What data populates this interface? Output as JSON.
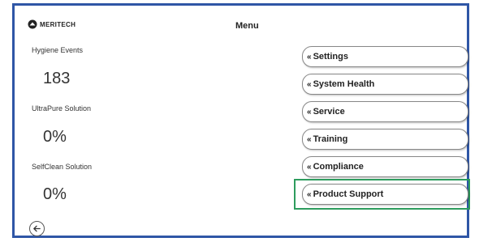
{
  "header": {
    "logo_text": "MERITECH",
    "title": "Menu"
  },
  "stats": [
    {
      "label": "Hygiene Events",
      "value": "183"
    },
    {
      "label": "UltraPure Solution",
      "value": "0%"
    },
    {
      "label": "SelfClean Solution",
      "value": "0%"
    }
  ],
  "menu": {
    "chevron": "«",
    "items": [
      {
        "label": "Settings"
      },
      {
        "label": "System Health"
      },
      {
        "label": "Service"
      },
      {
        "label": "Training"
      },
      {
        "label": "Compliance"
      },
      {
        "label": "Product Support",
        "highlighted": true
      }
    ]
  },
  "colors": {
    "frame": "#2f56a6",
    "highlight": "#2e9c5e"
  },
  "icons": {
    "back": "arrow-left-icon",
    "logo": "meritech-logo-icon"
  }
}
